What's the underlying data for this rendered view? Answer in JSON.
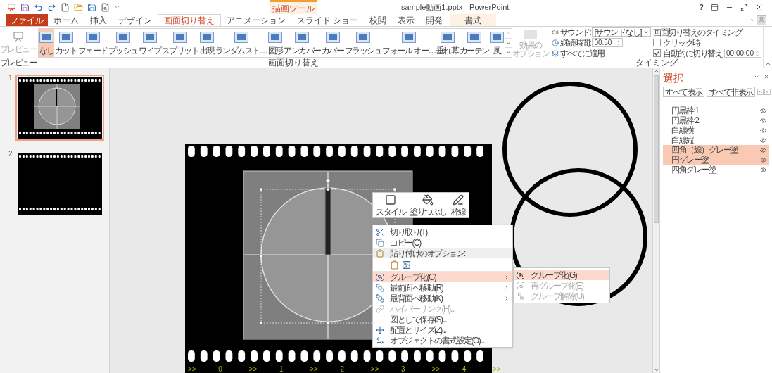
{
  "window": {
    "title": "sample動画1.pptx - PowerPoint",
    "help": "?"
  },
  "contextual_group": "描画ツール",
  "tabs": [
    {
      "label": "ファイル",
      "kind": "file",
      "selected": false
    },
    {
      "label": "ホーム",
      "kind": "normal",
      "selected": false
    },
    {
      "label": "挿入",
      "kind": "normal",
      "selected": false
    },
    {
      "label": "デザイン",
      "kind": "normal",
      "selected": false
    },
    {
      "label": "画面切り替え",
      "kind": "normal",
      "selected": true
    },
    {
      "label": "アニメーション",
      "kind": "normal",
      "selected": false
    },
    {
      "label": "スライド ショー",
      "kind": "normal",
      "selected": false
    },
    {
      "label": "校閲",
      "kind": "normal",
      "selected": false
    },
    {
      "label": "表示",
      "kind": "normal",
      "selected": false
    },
    {
      "label": "開発",
      "kind": "normal",
      "selected": false
    },
    {
      "label": "書式",
      "kind": "contextual",
      "selected": false
    }
  ],
  "ribbon": {
    "preview": {
      "button": "プレビュー",
      "group": "プレビュー"
    },
    "transitions": [
      {
        "label": "なし",
        "selected": true
      },
      {
        "label": "カット",
        "selected": false
      },
      {
        "label": "フェード",
        "selected": false
      },
      {
        "label": "プッシュ",
        "selected": false
      },
      {
        "label": "ワイプ",
        "selected": false
      },
      {
        "label": "スプリット",
        "selected": false
      },
      {
        "label": "出現",
        "selected": false
      },
      {
        "label": "ランダムスト…",
        "selected": false
      },
      {
        "label": "図形",
        "selected": false
      },
      {
        "label": "アンカバー",
        "selected": false
      },
      {
        "label": "カバー",
        "selected": false
      },
      {
        "label": "フラッシュ",
        "selected": false
      },
      {
        "label": "フォール オー…",
        "selected": false
      },
      {
        "label": "垂れ幕",
        "selected": false
      },
      {
        "label": "カーテン",
        "selected": false
      },
      {
        "label": "風",
        "selected": false
      }
    ],
    "transitions_group": "画面切り替え",
    "effect_options": {
      "lines": [
        "効果の",
        "オプション"
      ],
      "disabled": true
    },
    "timing": {
      "sound_label": "サウンド:",
      "sound_value": "[サウンドなし]",
      "duration_label": "継続時間:",
      "duration_value": "00.50",
      "apply_all": "すべてに適用",
      "heading": "画面切り替えのタイミング",
      "on_click": {
        "label": "クリック時",
        "checked": false
      },
      "after": {
        "label": "自動的に切り替え",
        "checked": true,
        "value": "00:00.00"
      },
      "group": "タイミング"
    }
  },
  "slides": [
    {
      "number": "1",
      "selected": true,
      "kind": "film_clock"
    },
    {
      "number": "2",
      "selected": false,
      "kind": "film_blank"
    }
  ],
  "slide": {
    "timeline_labels": [
      ">>",
      "0",
      ">>",
      "1",
      ">>",
      "2",
      ">>",
      "3",
      ">>",
      "4",
      ">>"
    ]
  },
  "mini_toolbar": [
    {
      "label": "スタイル",
      "kind": "style"
    },
    {
      "label": "塗りつぶし",
      "kind": "fill"
    },
    {
      "label": "枠線",
      "kind": "outline"
    }
  ],
  "context_menu": [
    {
      "kind": "item",
      "label": "切り取り(T)",
      "disabled": false,
      "highlighted": false,
      "submenu": false
    },
    {
      "kind": "item",
      "label": "コピー(C)",
      "disabled": false,
      "highlighted": false,
      "submenu": false
    },
    {
      "kind": "header",
      "label": "貼り付けのオプション:"
    },
    {
      "kind": "paste_options"
    },
    {
      "kind": "item",
      "label": "グループ化(G)",
      "disabled": false,
      "highlighted": true,
      "submenu": true
    },
    {
      "kind": "item",
      "label": "最前面へ移動(R)",
      "disabled": false,
      "highlighted": false,
      "submenu": true
    },
    {
      "kind": "item",
      "label": "最背面へ移動(K)",
      "disabled": false,
      "highlighted": false,
      "submenu": true
    },
    {
      "kind": "item",
      "label": "ハイパーリンク(H)...",
      "disabled": true,
      "highlighted": false,
      "submenu": false
    },
    {
      "kind": "item",
      "label": "図として保存(S)...",
      "disabled": false,
      "highlighted": false,
      "submenu": false
    },
    {
      "kind": "item",
      "label": "配置とサイズ(Z)...",
      "disabled": false,
      "highlighted": false,
      "submenu": false
    },
    {
      "kind": "item",
      "label": "オブジェクトの書式設定(O)...",
      "disabled": false,
      "highlighted": false,
      "submenu": false
    }
  ],
  "submenu": [
    {
      "label": "グループ化(G)",
      "disabled": false,
      "highlighted": true
    },
    {
      "label": "再グループ化(E)",
      "disabled": true,
      "highlighted": false
    },
    {
      "label": "グループ解除(U)",
      "disabled": true,
      "highlighted": false
    }
  ],
  "selection_pane": {
    "title": "選択",
    "buttons": [
      "すべて表示",
      "すべて非表示"
    ],
    "items": [
      {
        "label": "円黒枠 1",
        "selected": false
      },
      {
        "label": "円黒枠 2",
        "selected": false
      },
      {
        "label": "白線横",
        "selected": false
      },
      {
        "label": "白線縦",
        "selected": false
      },
      {
        "label": "四角（線）グレー塗",
        "selected": true
      },
      {
        "label": "円グレー塗",
        "selected": true
      },
      {
        "label": "四角グレー塗",
        "selected": false
      }
    ]
  }
}
